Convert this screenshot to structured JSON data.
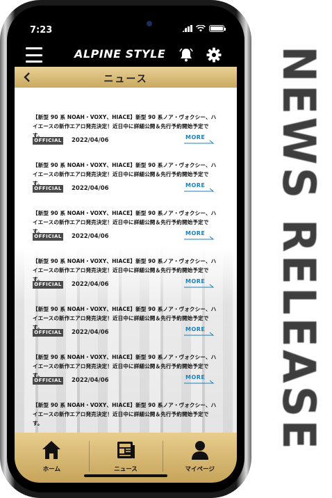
{
  "side_text": "NEWS RELEASE",
  "status_bar": {
    "time": "7:23"
  },
  "header": {
    "logo": "ALPINE STYLE",
    "menu_icon": "menu-icon",
    "bell_icon": "bell-icon",
    "gear_icon": "gear-icon"
  },
  "title_bar": {
    "back_icon": "chevron-left-icon",
    "title": "ニュース"
  },
  "news": [
    {
      "text": "【新型 90 系 NOAH・VOXY、HIACE】新型 90 系ノア・ヴォクシー、ハイエースの新作エアロ発売決定！近日中に詳細公開＆先行予約開始予定です。",
      "badge": "OFFICIAL",
      "date": "2022/04/06",
      "more": "MORE"
    },
    {
      "text": "【新型 90 系 NOAH・VOXY、HIACE】新型 90 系ノア・ヴォクシー、ハイエースの新作エアロ発売決定！近日中に詳細公開＆先行予約開始予定です。",
      "badge": "OFFICIAL",
      "date": "2022/04/06",
      "more": "MORE"
    },
    {
      "text": "【新型 90 系 NOAH・VOXY、HIACE】新型 90 系ノア・ヴォクシー、ハイエースの新作エアロ発売決定！近日中に詳細公開＆先行予約開始予定です。",
      "badge": "OFFICIAL",
      "date": "2022/04/06",
      "more": "MORE"
    },
    {
      "text": "【新型 90 系 NOAH・VOXY、HIACE】新型 90 系ノア・ヴォクシー、ハイエースの新作エアロ発売決定！近日中に詳細公開＆先行予約開始予定です。",
      "badge": "OFFICIAL",
      "date": "2022/04/06",
      "more": "MORE"
    },
    {
      "text": "【新型 90 系 NOAH・VOXY、HIACE】新型 90 系ノア・ヴォクシー、ハイエースの新作エアロ発売決定！近日中に詳細公開＆先行予約開始予定です。",
      "badge": "OFFICIAL",
      "date": "2022/04/06",
      "more": "MORE"
    },
    {
      "text": "【新型 90 系 NOAH・VOXY、HIACE】新型 90 系ノア・ヴォクシー、ハイエースの新作エアロ発売決定！近日中に詳細公開＆先行予約開始予定です。",
      "badge": "OFFICIAL",
      "date": "2022/04/06",
      "more": "MORE"
    },
    {
      "text": "【新型 90 系 NOAH・VOXY、HIACE】新型 90 系ノア・ヴォクシー、ハイエースの新作エアロ発売決定！近日中に詳細公開＆先行予約開始予定です。",
      "badge": "",
      "date": "",
      "more": ""
    }
  ],
  "tabs": [
    {
      "label": "ホーム",
      "icon": "home-icon"
    },
    {
      "label": "ニュース",
      "icon": "newspaper-icon"
    },
    {
      "label": "マイページ",
      "icon": "user-icon"
    }
  ],
  "colors": {
    "gold_light": "#e8cd8d",
    "gold_dark": "#c6a45a",
    "more_blue": "#1e7fb8",
    "badge_gray": "#4a4a4a"
  }
}
